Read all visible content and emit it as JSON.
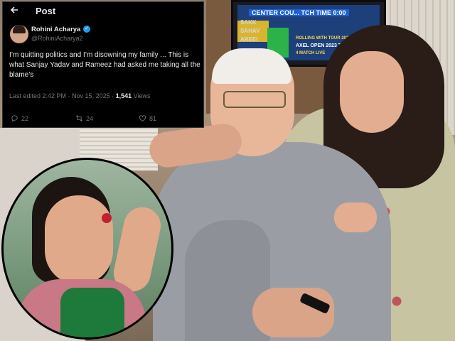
{
  "tweet": {
    "back_icon": "arrow-left-icon",
    "header_title": "Post",
    "author_name": "Rohini Acharya",
    "author_handle": "@RohiniAcharya2",
    "verified_icon": "verified-badge-icon",
    "text": "I’m quitting politics and I’m disowning my family ... This is what Sanjay Yadav and Rameez had asked me taking all the blame’s",
    "edited_label": "Last edited 2:42 PM · Nov 15, 2025 · ",
    "views_count": "1,541",
    "views_label": " Views",
    "actions": {
      "reply_count": "22",
      "retweet_count": "24",
      "like_count": "81"
    }
  },
  "tv": {
    "line1": "CENTER COU... TCH TIME 0:00",
    "line2": "SAKK",
    "line3": "SAHAV",
    "line4": "AREEI",
    "ticker1": "ROLLING WITH TOUR 2023",
    "ticker2": "AXEL OPEN 2023 TOUR",
    "ticker3": "4 MATCH LIVE"
  },
  "colors": {
    "tweet_bg": "#000000",
    "verified": "#1d9bf0",
    "muted_text": "#71767b"
  }
}
